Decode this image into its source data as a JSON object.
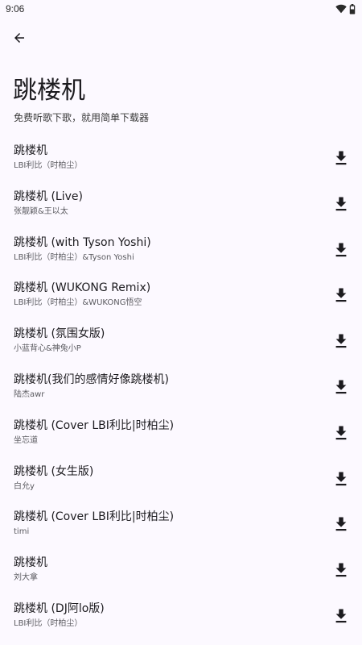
{
  "status_bar": {
    "time": "9:06",
    "icons": [
      "wifi-icon",
      "battery-icon"
    ]
  },
  "header": {
    "back_icon": "arrow-left-icon",
    "title": "跳楼机",
    "subtitle": "免费听歌下歌，就用简单下载器"
  },
  "songs": [
    {
      "title": "跳楼机",
      "artist": "LBI利比（时柏尘）"
    },
    {
      "title": "跳楼机 (Live)",
      "artist": "张靓颖&王以太"
    },
    {
      "title": "跳楼机 (with Tyson Yoshi)",
      "artist": "LBI利比（时柏尘）&Tyson Yoshi"
    },
    {
      "title": "跳楼机 (WUKONG Remix)",
      "artist": "LBI利比（时柏尘）&WUKONG悟空"
    },
    {
      "title": "跳楼机 (氛围女版)",
      "artist": "小蓝背心&神兔小P"
    },
    {
      "title": "跳楼机(我们的感情好像跳楼机)",
      "artist": "陆杰awr"
    },
    {
      "title": "跳楼机 (Cover LBI利比|时柏尘)",
      "artist": "坐忘道"
    },
    {
      "title": "跳楼机 (女生版)",
      "artist": "白允y"
    },
    {
      "title": "跳楼机 (Cover LBI利比|时柏尘)",
      "artist": "timi"
    },
    {
      "title": "跳楼机",
      "artist": "刘大拿"
    },
    {
      "title": "跳楼机 (DJ阿lo版)",
      "artist": "LBI利比（时柏尘）"
    }
  ],
  "row_icon": "download-icon"
}
